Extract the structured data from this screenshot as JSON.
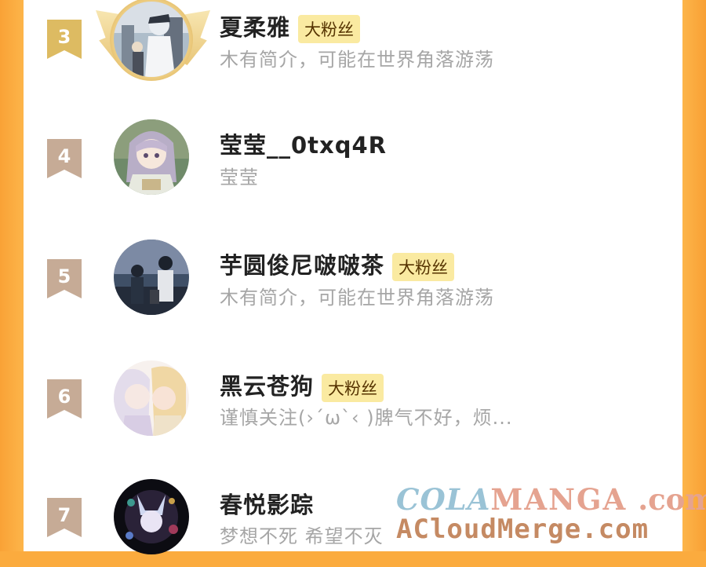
{
  "fans": [
    {
      "rank": "3",
      "name": "夏柔雅",
      "badge": "大粉丝",
      "bio": "木有简介，可能在世界角落游荡",
      "top_rank": true
    },
    {
      "rank": "4",
      "name": "莹莹__0txq4R",
      "badge": "",
      "bio": "莹莹"
    },
    {
      "rank": "5",
      "name": "芋圆俊尼啵啵茶",
      "badge": "大粉丝",
      "bio": "木有简介，可能在世界角落游荡"
    },
    {
      "rank": "6",
      "name": "黑云苍狗",
      "badge": "大粉丝",
      "bio": "谨慎关注(›´ω`‹ )脾气不好，烦..."
    },
    {
      "rank": "7",
      "name": "春悦影踪",
      "badge": "",
      "bio": "梦想不死 希望不灭"
    }
  ],
  "watermark": {
    "cola": "COLA",
    "manga": "MANGA",
    "com1": ".com",
    "line2": "ACloudMerge.com"
  },
  "colors": {
    "background": "#fbab3e",
    "badge_bg": "#faeaa1",
    "rank_flag": "#c6ab96",
    "rank_flag_gold": "#ddbb62"
  }
}
